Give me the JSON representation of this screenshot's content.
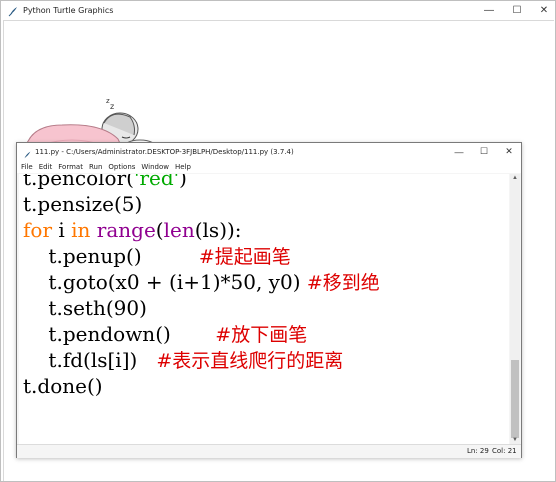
{
  "turtle_window": {
    "title": "Python Turtle Graphics"
  },
  "idle_window": {
    "title": "111.py - C:/Users/Administrator.DESKTOP-3FJBLPH/Desktop/111.py (3.7.4)",
    "menu": [
      "File",
      "Edit",
      "Format",
      "Run",
      "Options",
      "Window",
      "Help"
    ]
  },
  "code": {
    "line0": "t.pencolor(",
    "line0_str": "'red'",
    "line0_end": ")",
    "line1": "t.pensize(5)",
    "line2_for": "for",
    "line2_i": " i ",
    "line2_in": "in",
    "line2_sp": " ",
    "line2_range": "range",
    "line2_paren": "(",
    "line2_len": "len",
    "line2_rest": "(ls)):",
    "line3": "    t.penup()         ",
    "line3_cm": "#提起画笔",
    "line4": "    t.goto(x0 + (i+1)*50, y0) ",
    "line4_cm": "#移到绝",
    "line5": "    t.seth(90)",
    "line6": "    t.pendown()       ",
    "line6_cm": "#放下画笔",
    "line7": "    t.fd(ls[i])   ",
    "line7_cm": "#表示直线爬行的距离",
    "line8": "t.done()"
  },
  "status": {
    "ln": "Ln: 29",
    "col": "Col: 21"
  },
  "colors": {
    "keyword": "#ff7700",
    "builtin": "#900090",
    "comment": "#dd0000",
    "string": "#00aa00"
  }
}
